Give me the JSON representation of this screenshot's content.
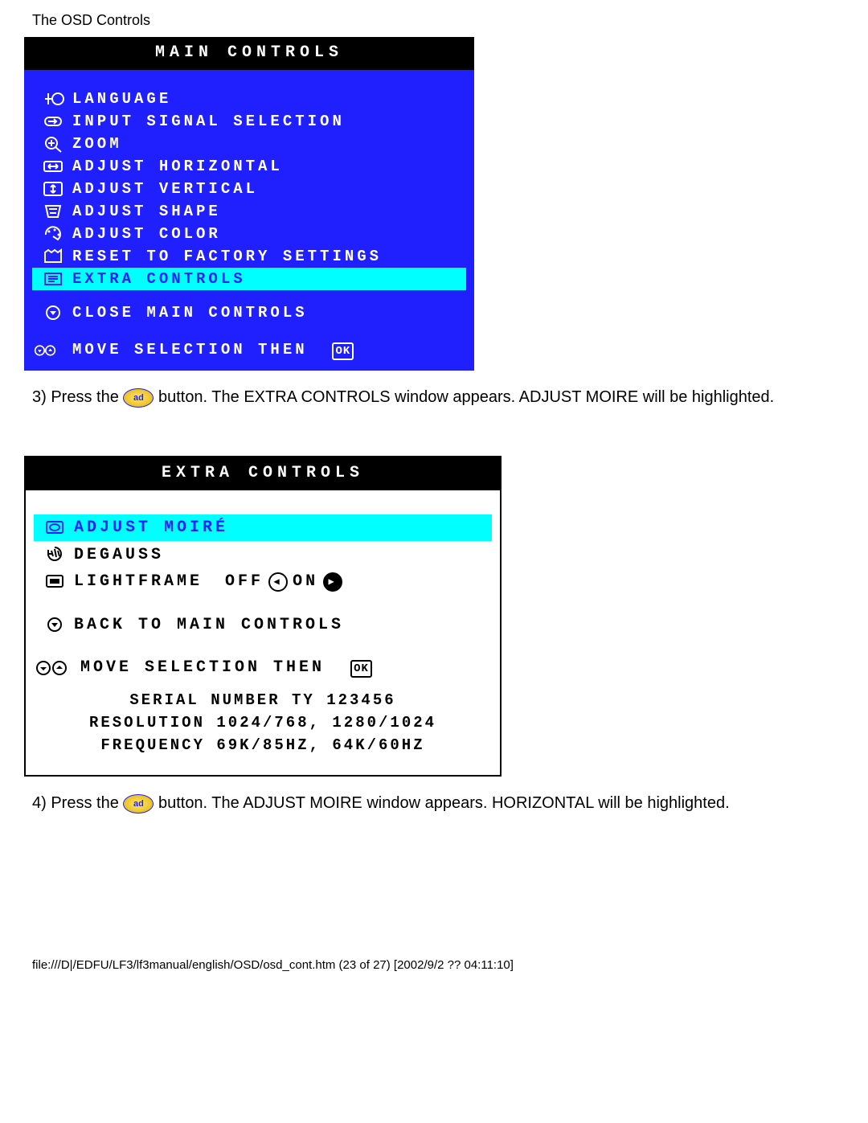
{
  "page": {
    "title": "The OSD Controls",
    "footer": "file:///D|/EDFU/LF3/lf3manual/english/OSD/osd_cont.htm (23 of 27) [2002/9/2 ?? 04:11:10]"
  },
  "main_controls": {
    "header": "MAIN CONTROLS",
    "items": [
      {
        "icon": "language-icon",
        "label": "LANGUAGE"
      },
      {
        "icon": "input-icon",
        "label": "INPUT SIGNAL SELECTION"
      },
      {
        "icon": "zoom-icon",
        "label": "ZOOM"
      },
      {
        "icon": "horiz-icon",
        "label": "ADJUST HORIZONTAL"
      },
      {
        "icon": "vert-icon",
        "label": "ADJUST VERTICAL"
      },
      {
        "icon": "shape-icon",
        "label": "ADJUST SHAPE"
      },
      {
        "icon": "color-icon",
        "label": "ADJUST COLOR"
      },
      {
        "icon": "reset-icon",
        "label": "RESET TO FACTORY SETTINGS"
      },
      {
        "icon": "extra-icon",
        "label": "EXTRA CONTROLS",
        "highlight": true
      }
    ],
    "close": {
      "icon": "down-circle-icon",
      "label": "CLOSE MAIN CONTROLS"
    },
    "hint": {
      "label": "MOVE SELECTION THEN",
      "ok": "OK"
    }
  },
  "step3": {
    "prefix": "3) Press the ",
    "button": "ad",
    "suffix": " button. The EXTRA CONTROLS window appears. ADJUST MOIRE will be highlighted."
  },
  "extra_controls": {
    "header": "EXTRA CONTROLS",
    "items": [
      {
        "icon": "moire-icon",
        "label": "ADJUST MOIRÉ",
        "highlight": true
      },
      {
        "icon": "degauss-icon",
        "label": "DEGAUSS"
      },
      {
        "icon": "lightframe-icon",
        "label": "LIGHTFRAME",
        "off": "OFF",
        "on": "ON"
      }
    ],
    "back": {
      "icon": "down-circle-icon",
      "label": "BACK TO MAIN CONTROLS"
    },
    "hint": {
      "label": "MOVE SELECTION THEN",
      "ok": "OK"
    },
    "info": {
      "serial": "SERIAL NUMBER TY 123456",
      "resolution": "RESOLUTION 1024/768, 1280/1024",
      "frequency": "FREQUENCY 69K/85HZ, 64K/60HZ"
    }
  },
  "step4": {
    "prefix": "4) Press the ",
    "button": "ad",
    "suffix": " button. The ADJUST MOIRE window appears. HORIZONTAL will be highlighted."
  }
}
